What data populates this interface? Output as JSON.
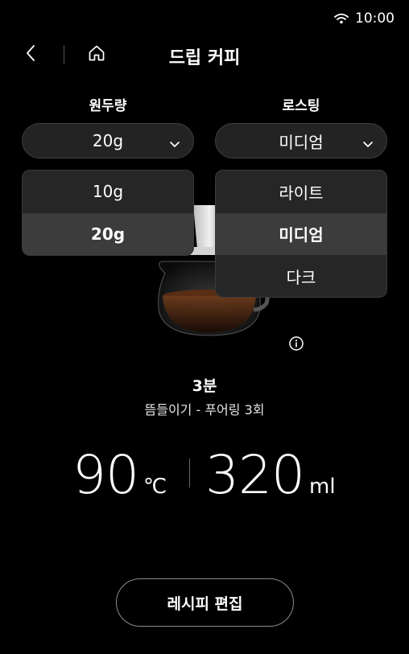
{
  "status_bar": {
    "time": "10:00",
    "icon": "wifi-icon"
  },
  "header": {
    "title": "드립 커피",
    "back_icon": "chevron-left-icon",
    "home_icon": "home-icon"
  },
  "bean_amount": {
    "label": "원두량",
    "selected": "20g",
    "options": [
      {
        "label": "10g",
        "selected": false
      },
      {
        "label": "20g",
        "selected": true
      }
    ]
  },
  "roasting": {
    "label": "로스팅",
    "selected": "미디엄",
    "options": [
      {
        "label": "라이트",
        "selected": false
      },
      {
        "label": "미디엄",
        "selected": true
      },
      {
        "label": "다크",
        "selected": false
      }
    ]
  },
  "recipe": {
    "time": "3분",
    "method": "뜸들이기 - 푸어링 3회",
    "temperature": "90",
    "temperature_unit": "℃",
    "volume": "320",
    "volume_unit": "ml"
  },
  "actions": {
    "edit_label": "레시피 편집"
  },
  "colors": {
    "background": "#000000",
    "panel": "#262626",
    "selected_item": "#3c3c3c"
  }
}
